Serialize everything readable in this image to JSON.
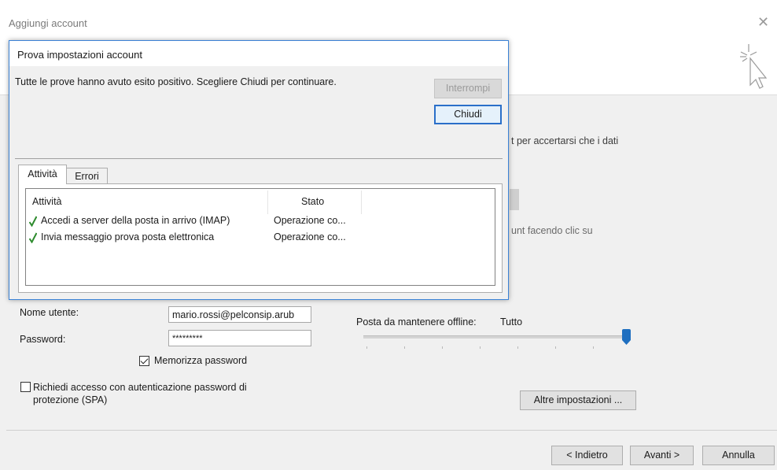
{
  "window": {
    "title": "Aggiungi account",
    "close_glyph": "✕"
  },
  "background": {
    "text_1": "t per accertarsi che i dati",
    "text_2": "unt facendo clic su"
  },
  "login": {
    "username_label": "Nome utente:",
    "username_value": "mario.rossi@pelconsip.arub",
    "password_label": "Password:",
    "password_value": "*********",
    "remember_label": "Memorizza password",
    "remember_checked": true,
    "spa_label_line1": "Richiedi accesso con autenticazione password di",
    "spa_label_line2": "protezione (SPA)",
    "spa_checked": false
  },
  "offline": {
    "label": "Posta da mantenere offline:",
    "value": "Tutto",
    "slider_level": 1.0
  },
  "buttons": {
    "more_settings": "Altre impostazioni ...",
    "back": "< Indietro",
    "next": "Avanti >",
    "cancel": "Annulla"
  },
  "dialog": {
    "title": "Prova impostazioni account",
    "message": "Tutte le prove hanno avuto esito positivo. Scegliere Chiudi per continuare.",
    "stop_label": "Interrompi",
    "close_label": "Chiudi",
    "tabs": [
      "Attività",
      "Errori"
    ],
    "columns": [
      "Attività",
      "Stato"
    ],
    "rows": [
      {
        "task": "Accedi a server della posta in arrivo (IMAP)",
        "status": "Operazione co..."
      },
      {
        "task": "Invia messaggio prova posta elettronica",
        "status": "Operazione co..."
      }
    ]
  },
  "colors": {
    "accent": "#2a6fc9",
    "check": "#2e8b2e",
    "slider": "#1f6fc0"
  },
  "icons": [
    "wizard-cursor-icon",
    "close-icon",
    "checkmark-icon"
  ]
}
